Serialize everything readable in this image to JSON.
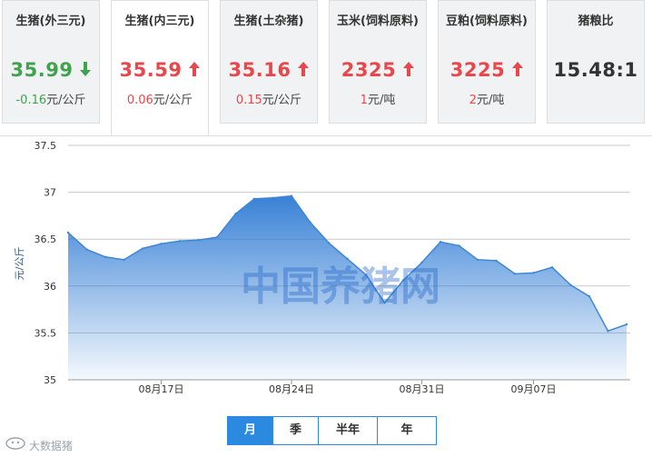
{
  "tabs": [
    {
      "name": "生猪(外三元)",
      "price": "35.99",
      "direction": "down",
      "change": "-0.16",
      "unit": "元/公斤"
    },
    {
      "name": "生猪(内三元)",
      "price": "35.59",
      "direction": "up",
      "change": "0.06",
      "unit": "元/公斤"
    },
    {
      "name": "生猪(土杂猪)",
      "price": "35.16",
      "direction": "up",
      "change": "0.15",
      "unit": "元/公斤"
    },
    {
      "name": "玉米(饲料原料)",
      "price": "2325",
      "direction": "up",
      "change": "1",
      "unit": "元/吨"
    },
    {
      "name": "豆粕(饲料原料)",
      "price": "3225",
      "direction": "up",
      "change": "2",
      "unit": "元/吨"
    },
    {
      "name": "猪粮比",
      "price": "15.48:1",
      "direction": "none",
      "change": "",
      "unit": ""
    }
  ],
  "active_tab": 1,
  "watermark": "中国养猪网",
  "range_buttons": [
    "月",
    "季",
    "半年",
    "年"
  ],
  "active_range": 0,
  "brand": "大数据猪",
  "colors": {
    "up": "#e8474b",
    "down": "#3fa34d",
    "accent": "#2b8ae0",
    "line": "#3d86d6"
  },
  "chart_data": {
    "type": "area",
    "title": "",
    "xlabel": "",
    "ylabel": "元/公斤",
    "ylim": [
      35,
      37.5
    ],
    "yticks": [
      35,
      35.5,
      36,
      36.5,
      37,
      37.5
    ],
    "ytick_labels": [
      "35",
      "35.5",
      "36",
      "36.5",
      "37",
      "37.5"
    ],
    "xtick_labels": [
      "08月17日",
      "08月24日",
      "08月31日",
      "09月07日"
    ],
    "xtick_positions": [
      5,
      12,
      19,
      25
    ],
    "grid": true,
    "legend": "none",
    "series": [
      {
        "values": [
          36.57,
          36.39,
          36.31,
          36.28,
          36.4,
          36.45,
          36.48,
          36.49,
          36.52,
          36.77,
          36.93,
          36.94,
          36.96,
          36.68,
          36.46,
          36.29,
          36.12,
          35.82,
          36.06,
          36.25,
          36.47,
          36.43,
          36.28,
          36.27,
          36.13,
          36.14,
          36.2,
          36.01,
          35.89,
          35.52,
          35.59
        ]
      }
    ]
  }
}
